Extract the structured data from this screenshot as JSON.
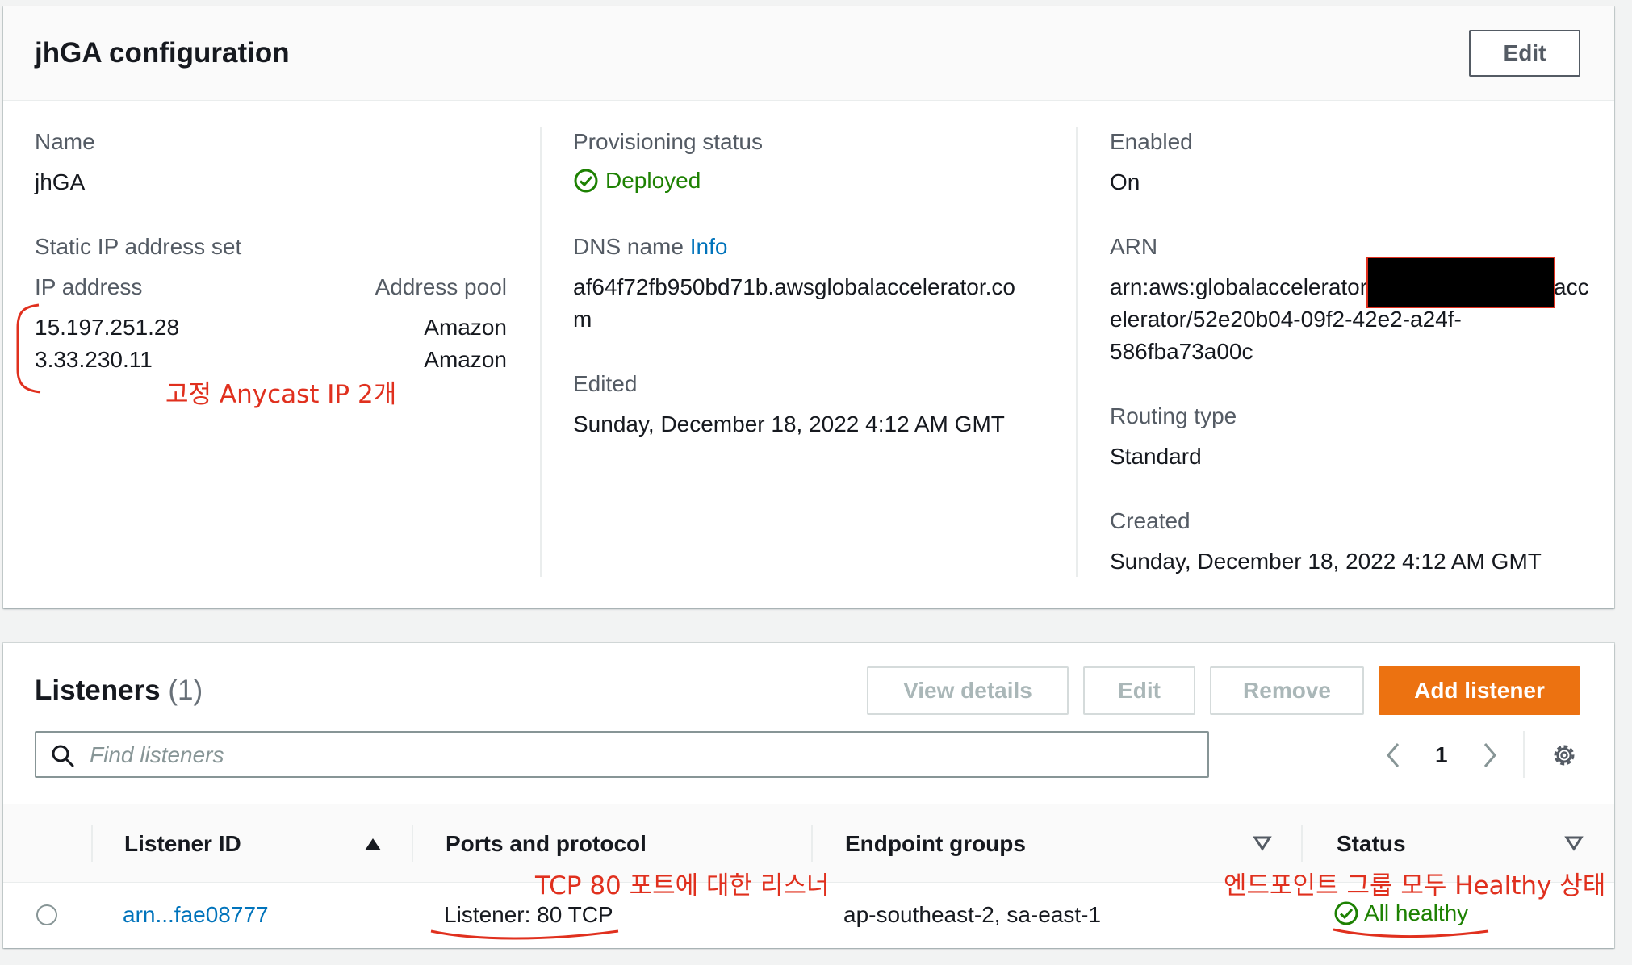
{
  "config": {
    "title": "jhGA configuration",
    "edit_label": "Edit",
    "name_label": "Name",
    "name_value": "jhGA",
    "static_ip_label": "Static IP address set",
    "ip_col_label": "IP address",
    "pool_col_label": "Address pool",
    "ips": [
      {
        "ip": "15.197.251.28",
        "pool": "Amazon"
      },
      {
        "ip": "3.33.230.11",
        "pool": "Amazon"
      }
    ],
    "provisioning_label": "Provisioning status",
    "provisioning_value": "Deployed",
    "dns_label": "DNS name",
    "dns_info": "Info",
    "dns_value_1": "af64f72fb950bd71b.awsglobalaccelerator.co",
    "dns_value_2": "m",
    "edited_label": "Edited",
    "edited_value": "Sunday, December 18, 2022 4:12 AM GMT",
    "enabled_label": "Enabled",
    "enabled_value": "On",
    "arn_label": "ARN",
    "arn_value_1": "arn:aws:globalaccelerator",
    "arn_value_1_tail": "acc",
    "arn_value_2": "elerator/52e20b04-09f2-42e2-a24f-",
    "arn_value_3": "586fba73a00c",
    "routing_label": "Routing type",
    "routing_value": "Standard",
    "created_label": "Created",
    "created_value": "Sunday, December 18, 2022 4:12 AM GMT"
  },
  "listeners": {
    "title": "Listeners",
    "count": "(1)",
    "view_details_label": "View details",
    "edit_label": "Edit",
    "remove_label": "Remove",
    "add_label": "Add listener",
    "search_placeholder": "Find listeners",
    "page_number": "1",
    "columns": {
      "id": "Listener ID",
      "ports": "Ports and protocol",
      "endpoints": "Endpoint groups",
      "status": "Status"
    },
    "rows": [
      {
        "id": "arn...fae08777",
        "ports": "Listener: 80 TCP",
        "endpoints": "ap-southeast-2, sa-east-1",
        "status": "All healthy"
      }
    ]
  },
  "annotations": {
    "anycast_note": "고정 Anycast IP 2개",
    "listener_note": "TCP 80 포트에 대한 리스너",
    "health_note": "엔드포인트 그룹 모두 Healthy 상태"
  },
  "colors": {
    "accent": "#ec7211",
    "link": "#0073bb",
    "success": "#1d8102",
    "annotation": "#e0301e"
  }
}
